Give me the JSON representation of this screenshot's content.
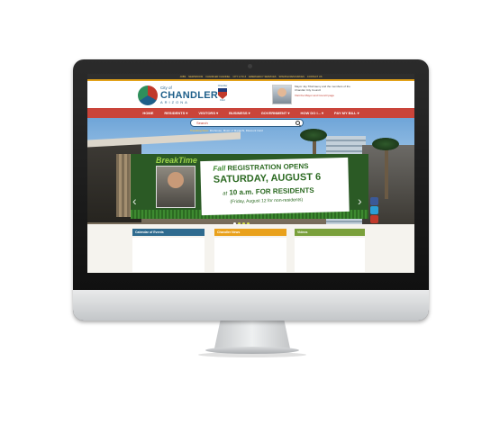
{
  "utility_bar": {
    "links": [
      "JOBS",
      "NEWSROOM",
      "CHANDLER CHANNEL",
      "CITY A TO Z",
      "EMERGENCY SERVICES",
      "SPANISH RESOURCES",
      "CONTACT US"
    ]
  },
  "header": {
    "logo_city": "City of",
    "logo_name": "CHANDLER",
    "logo_state": "ARIZONA",
    "badge_top": "Chandler",
    "badge_year": "1912",
    "mayor_text": "Mayor Jay Tibshraeny and the members of the Chandler City Council",
    "mayor_link": "Visit the Mayor and Council page"
  },
  "nav": {
    "items": [
      "HOME",
      "RESIDENTS ▾",
      "VISITORS ▾",
      "BUSINESS ▾",
      "GOVERNMENT ▾",
      "HOW DO I... ▾",
      "PAY MY BILL ▾"
    ]
  },
  "search": {
    "placeholder": "Search",
    "trending_label": "Trending Now:",
    "trending_items": "Firehouse, Music of Mariachi, Discount Card"
  },
  "banner": {
    "brand": "BreakTime",
    "line1_prefix": "Fall",
    "line1": "REGISTRATION OPENS",
    "line2": "SATURDAY, AUGUST 6",
    "line3_prefix": "at",
    "line3": "10 a.m. FOR RESIDENTS",
    "line4": "(Friday, August 12 for non-residents)",
    "arrow_prev": "‹",
    "arrow_next": "›"
  },
  "tiles": [
    "Calendar of Events",
    "Chandler News",
    "Videos"
  ],
  "colors": {
    "nav": "#c9443a",
    "accent": "#e3a21a",
    "brand_blue": "#1e5f8a",
    "banner_green": "#2c6a22"
  },
  "icons": [
    "search-icon",
    "facebook-icon",
    "twitter-icon",
    "youtube-icon",
    "rss-icon",
    "chevron-left-icon",
    "chevron-right-icon"
  ]
}
